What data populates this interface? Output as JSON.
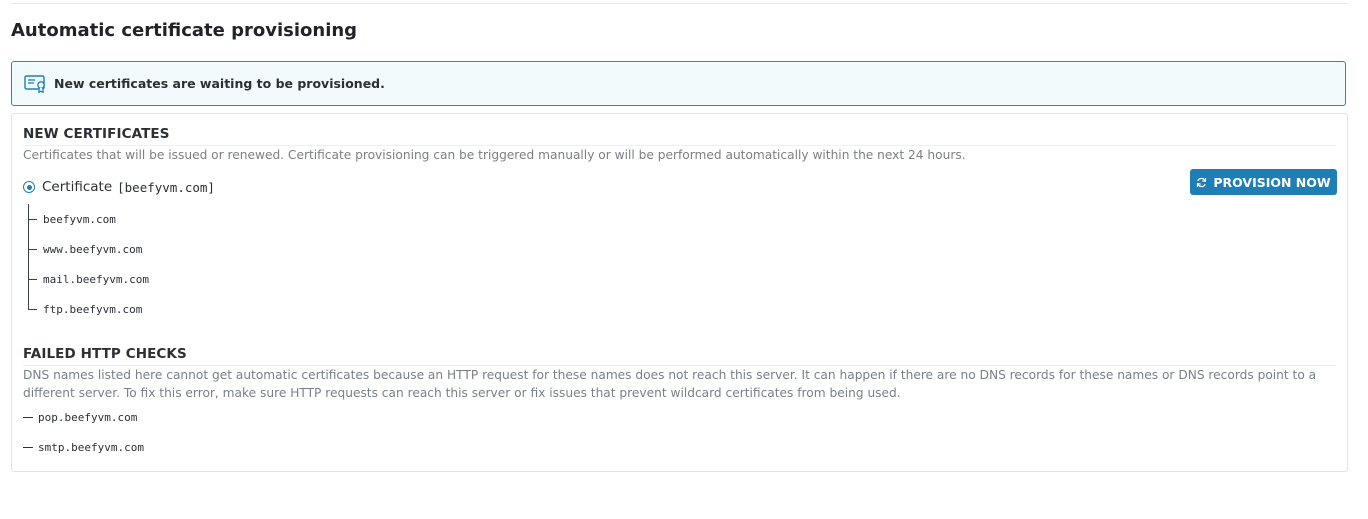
{
  "page": {
    "title": "Automatic certificate provisioning"
  },
  "notice": {
    "icon": "certificate-icon",
    "text": "New certificates are waiting to be provisioned."
  },
  "new_certificates": {
    "title": "NEW CERTIFICATES",
    "description": "Certificates that will be issued or renewed. Certificate provisioning can be triggered manually or will be performed automatically within the next 24 hours.",
    "certificate": {
      "label": "Certificate",
      "name": "[beefyvm.com]",
      "domains": [
        "beefyvm.com",
        "www.beefyvm.com",
        "mail.beefyvm.com",
        "ftp.beefyvm.com"
      ]
    },
    "provision_button": {
      "label": "PROVISION NOW",
      "icon": "refresh-icon"
    }
  },
  "failed_http_checks": {
    "title": "FAILED HTTP CHECKS",
    "description": "DNS names listed here cannot get automatic certificates because an HTTP request for these names does not reach this server. It can happen if there are no DNS records for these names or DNS records point to a different server. To fix this error, make sure HTTP requests can reach this server or fix issues that prevent wildcard certificates from being used.",
    "names": [
      "pop.beefyvm.com",
      "smtp.beefyvm.com"
    ]
  },
  "colors": {
    "accent": "#1f7fb5",
    "notice_border": "#2a8ca3",
    "notice_bg": "#f2fbfc"
  }
}
